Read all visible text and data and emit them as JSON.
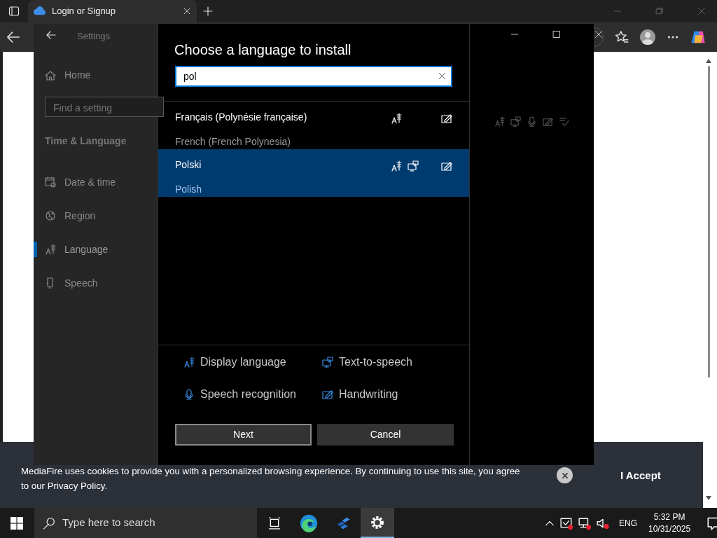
{
  "browser": {
    "tab_title": "Login or Signup"
  },
  "settings": {
    "title": "Settings",
    "home": "Home",
    "search": {
      "placeholder": "Find a setting"
    },
    "section": "Time & Language",
    "items": [
      {
        "kind": "date",
        "label": "Date & time",
        "selected": false
      },
      {
        "kind": "region",
        "label": "Region",
        "selected": false
      },
      {
        "kind": "language",
        "label": "Language",
        "selected": true
      },
      {
        "kind": "speech",
        "label": "Speech",
        "selected": false
      }
    ]
  },
  "dialog": {
    "title": "Choose a language to install",
    "search": {
      "value": "pol"
    },
    "results": [
      {
        "name": "Français (Polynésie française)",
        "english": "French (French Polynesia)",
        "selected": false,
        "features": {
          "display_language": true,
          "text_to_speech": false,
          "speech_recognition": false,
          "handwriting": true
        }
      },
      {
        "name": "Polski",
        "english": "Polish",
        "selected": true,
        "features": {
          "display_language": true,
          "text_to_speech": true,
          "speech_recognition": false,
          "handwriting": true
        }
      }
    ],
    "legend": [
      {
        "kind": "display_language",
        "label": "Display language"
      },
      {
        "kind": "text_to_speech",
        "label": "Text-to-speech"
      },
      {
        "kind": "speech_recognition",
        "label": "Speech recognition"
      },
      {
        "kind": "handwriting",
        "label": "Handwriting"
      }
    ],
    "buttons": [
      {
        "label": "Next",
        "focused": true
      },
      {
        "label": "Cancel",
        "focused": false
      }
    ]
  },
  "cookie_banner": {
    "text": "MediaFire uses cookies to provide you with a personalized browsing experience. By continuing to use this site, you agree to our Privacy Policy.",
    "accept": "I Accept"
  },
  "taskbar": {
    "search": {
      "placeholder": "Type here to search"
    },
    "apps": [
      {
        "kind": "task_view",
        "active": false
      },
      {
        "kind": "edge",
        "active": false
      },
      {
        "kind": "app",
        "active": false
      },
      {
        "kind": "settings",
        "active": true
      }
    ],
    "language": "ENG",
    "time": "5:32 PM",
    "date": "10/31/2025"
  }
}
